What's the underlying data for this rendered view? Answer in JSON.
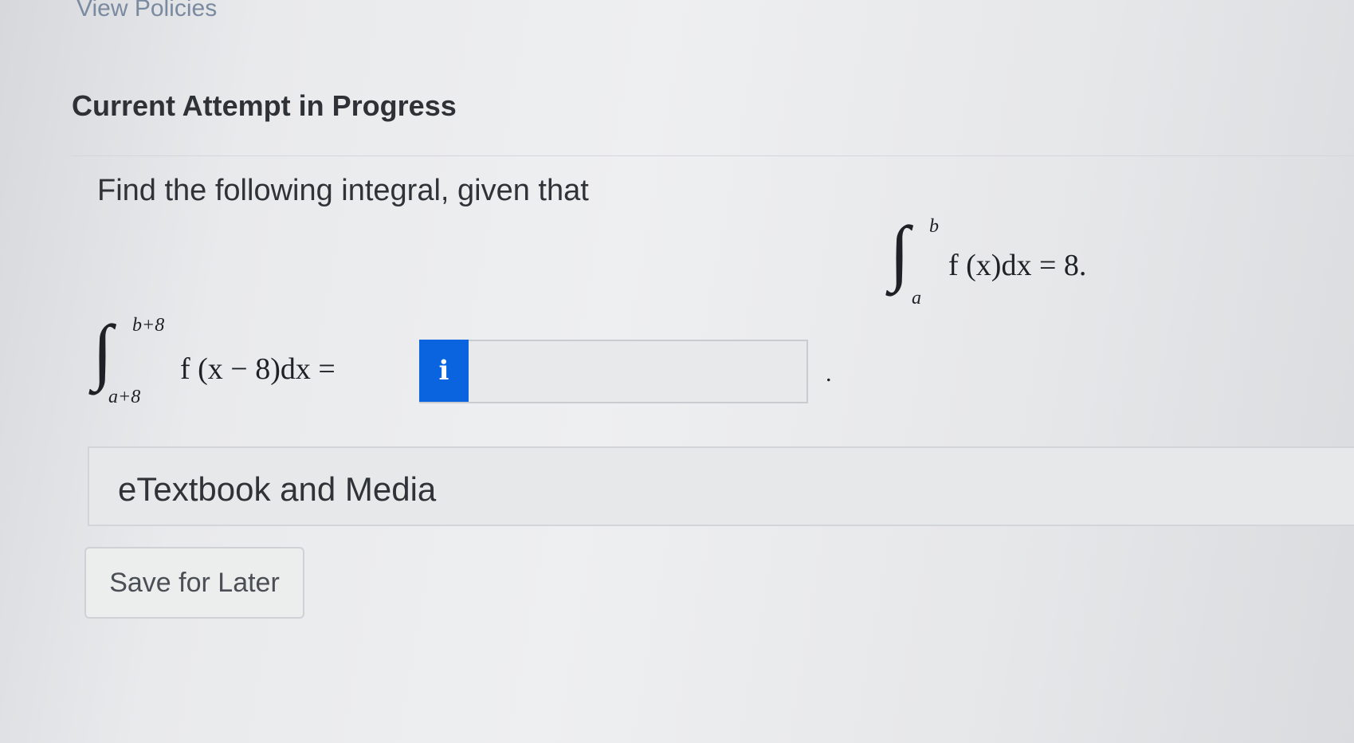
{
  "header": {
    "view_policies_link": "View Policies",
    "title": "Current Attempt in Progress"
  },
  "question": {
    "prompt": "Find the following integral, given that",
    "given": {
      "upper_limit": "b",
      "lower_limit": "a",
      "integrand": "f (x)dx = 8."
    },
    "target": {
      "upper_limit": "b+8",
      "lower_limit": "a+8",
      "integrand": "f (x − 8)dx ="
    },
    "answer": {
      "info_icon": "i",
      "value": "",
      "trailing": "."
    }
  },
  "resources": {
    "etextbook_label": "eTextbook and Media"
  },
  "actions": {
    "save_for_later": "Save for Later"
  },
  "colors": {
    "info_button": "#0a64e0",
    "link": "#7a8aa0"
  }
}
